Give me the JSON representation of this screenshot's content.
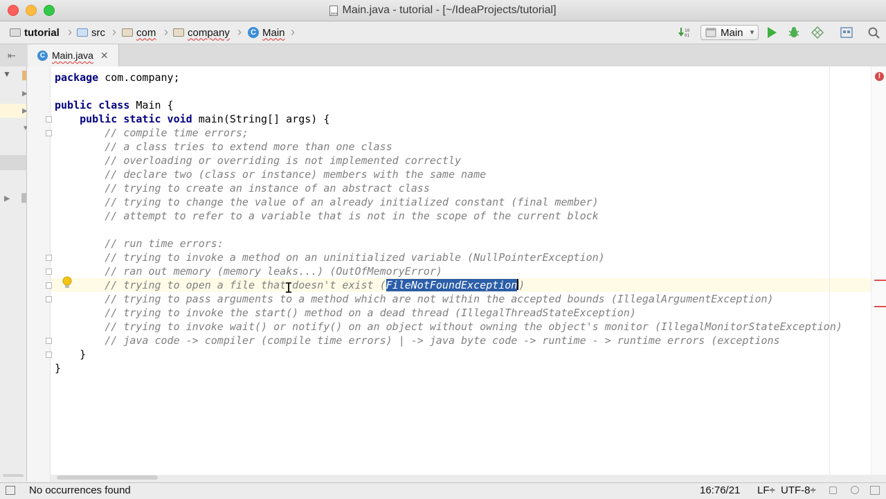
{
  "window": {
    "title": "Main.java - tutorial - [~/IdeaProjects/tutorial]",
    "file_icon_label": "java"
  },
  "breadcrumb": {
    "items": [
      "tutorial",
      "src",
      "com",
      "company",
      "Main"
    ],
    "class_icon_letter": "C"
  },
  "toolbar": {
    "run_config": "Main",
    "counter_icon_text": "10\n01"
  },
  "tabs": [
    {
      "label": "Main.java"
    }
  ],
  "code": {
    "lines": [
      {
        "kw": "package",
        "rest": " com.company;"
      },
      {
        "blank": true
      },
      {
        "kw": "public class",
        "rest": " Main {"
      },
      {
        "indent": "    ",
        "kw": "public static void",
        "rest": " main(String[] args) {"
      },
      {
        "indent": "        ",
        "comment": "// compile time errors;"
      },
      {
        "indent": "        ",
        "comment": "// a class tries to extend more than one class"
      },
      {
        "indent": "        ",
        "comment": "// overloading or overriding is not implemented correctly"
      },
      {
        "indent": "        ",
        "comment": "// declare two (class or instance) members with the same name"
      },
      {
        "indent": "        ",
        "comment": "// trying to create an instance of an abstract class"
      },
      {
        "indent": "        ",
        "comment": "// trying to change the value of an already initialized constant (final member)"
      },
      {
        "indent": "        ",
        "comment": "// attempt to refer to a variable that is not in the scope of the current block"
      },
      {
        "blank": true
      },
      {
        "indent": "        ",
        "comment": "// run time errors:"
      },
      {
        "indent": "        ",
        "comment": "// trying to invoke a method on an uninitialized variable (NullPointerException)"
      },
      {
        "indent": "        ",
        "comment": "// ran out memory (memory leaks...) (OutOfMemoryError)"
      },
      {
        "indent": "        ",
        "comment_pre": "// trying to open a file that doesn't exist (",
        "selected": "FileNotFoundException",
        "comment_post": ")"
      },
      {
        "indent": "        ",
        "comment": "// trying to pass arguments to a method which are not within the accepted bounds (IllegalArgumentException)"
      },
      {
        "indent": "        ",
        "comment": "// trying to invoke the start() method on a dead thread (IllegalThreadStateException)"
      },
      {
        "indent": "        ",
        "comment": "// trying to invoke wait() or notify() on an object without owning the object's monitor (IllegalMonitorStateException)"
      },
      {
        "indent": "        ",
        "comment": "// java code -> compiler (compile time errors) | -> java byte code -> runtime - > runtime errors (exceptions"
      },
      {
        "indent": "    ",
        "rest": "}"
      },
      {
        "rest": "}"
      }
    ]
  },
  "status": {
    "message": "No occurrences found",
    "position": "16:76/21",
    "line_separator": "LF÷",
    "encoding": "UTF-8÷",
    "error_badge": "!"
  },
  "colors": {
    "keyword": "#000080",
    "comment": "#808080",
    "selection": "#2b5ea8",
    "error": "#e05050"
  }
}
